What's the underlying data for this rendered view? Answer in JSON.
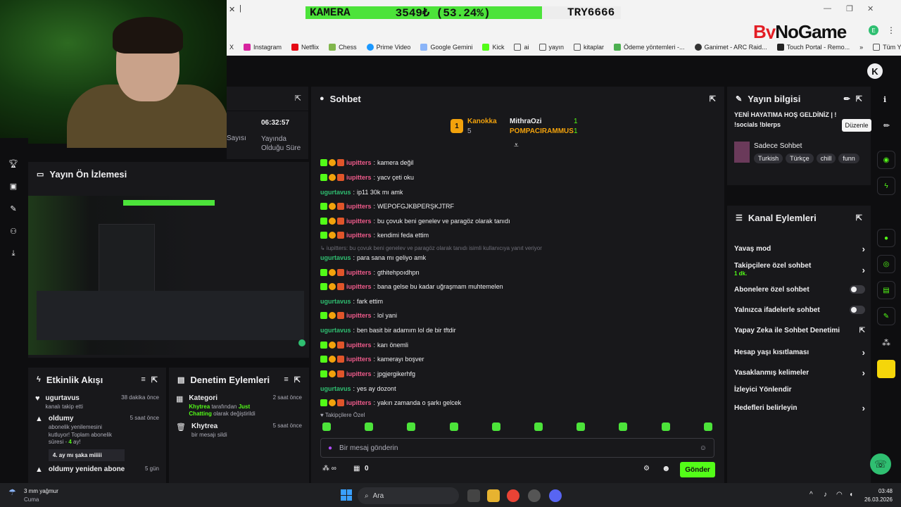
{
  "browser": {
    "stat_bar": {
      "label": "KAMERA",
      "value": "3549₺ (53.24%)",
      "fill_percent": 75,
      "code": "TRY6666"
    },
    "bookmarks": [
      "X",
      "Instagram",
      "Netflix",
      "Chess",
      "Prime Video",
      "Google Gemini",
      "Kick",
      "ai",
      "yayın",
      "kitaplar",
      "Ödeme yöntemleri -...",
      "Ganimet - ARC Raid...",
      "Touch Portal - Remo...",
      "Tüm Yer İşaretleri"
    ],
    "logo": {
      "by": "By",
      "rest": "NoGame"
    },
    "badge": "E"
  },
  "stats": {
    "time": "06:32:57",
    "time_label": "Yayında Olduğu Süre",
    "left_label": "Sayısı"
  },
  "preview": {
    "title": "Yayın Ön İzlemesi"
  },
  "activity": {
    "title": "Etkinlik Akışı",
    "items": [
      {
        "name": "ugurtavus",
        "sub": "kanalı takip etti",
        "time": "38 dakika önce"
      },
      {
        "name": "oldumy",
        "sub": "abonelik yenilemesini kutluyor! Toplam abonelik süresi -",
        "months": "4",
        "sub2": "ay!",
        "quote": "4. ay mı şaka miiiii",
        "time": "5 saat önce"
      },
      {
        "name": "oldumy yeniden abone",
        "time": "5 gün"
      }
    ]
  },
  "moderation": {
    "title": "Denetim Eylemleri",
    "items": [
      {
        "name": "Kategori",
        "by": "Khytrea",
        "mid": "tarafından",
        "cat": "Just Chatting",
        "end": "olarak değiştirildi",
        "time": "2 saat önce"
      },
      {
        "name": "Khytrea",
        "sub": "bir mesajı sildi",
        "time": "5 saat önce"
      }
    ]
  },
  "chat": {
    "title": "Sohbet",
    "pinned": {
      "user1": "Kanokka",
      "count1": "5",
      "user2": "MithraOzi",
      "count2": "1",
      "user3": "POMPACIRAMMUS",
      "count3": "1",
      "rank": "1"
    },
    "messages": [
      {
        "user": "iupitters",
        "text": "kamera değil",
        "type": "p"
      },
      {
        "user": "iupitters",
        "text": "yacv çeti oku",
        "type": "p"
      },
      {
        "user": "ugurtavus",
        "text": "ip11 30k mı amk",
        "type": "g"
      },
      {
        "user": "iupitters",
        "text": "WEPOFGJKBPERŞKJTRF",
        "type": "p"
      },
      {
        "user": "iupitters",
        "text": "bu çovuk beni genelev ve paragöz olarak tanıdı",
        "type": "p"
      },
      {
        "user": "iupitters",
        "text": "kendimi feda ettim",
        "type": "p"
      },
      {
        "user": "",
        "text": "↳ iupitters: bu çovuk beni genelev ve paragöz olarak tanıdı isimli kullanıcıya yanıt veriyor",
        "type": "sys"
      },
      {
        "user": "ugurtavus",
        "text": "para sana mı geliyo amk",
        "type": "g"
      },
      {
        "user": "iupitters",
        "text": "gthitehpoıdhpn",
        "type": "p"
      },
      {
        "user": "iupitters",
        "text": "bana gelse bu kadar uğraşmam muhtemelen",
        "type": "p"
      },
      {
        "user": "ugurtavus",
        "text": "fark ettim",
        "type": "g"
      },
      {
        "user": "iupitters",
        "text": "lol yani",
        "type": "p"
      },
      {
        "user": "ugurtavus",
        "text": "ben basit bir adamım lol de bir tftdir",
        "type": "g"
      },
      {
        "user": "iupitters",
        "text": "karı önemli",
        "type": "p"
      },
      {
        "user": "iupitters",
        "text": "kamerayı boşver",
        "type": "p"
      },
      {
        "user": "iupitters",
        "text": "jpgjergikerhfg",
        "type": "p"
      },
      {
        "user": "ugurtavus",
        "text": "yes ay dozont",
        "type": "g"
      },
      {
        "user": "iupitters",
        "text": "yakın zamanda o şarkı gelcek",
        "type": "p"
      }
    ],
    "followers_only": "♥ Takipçilere Özel",
    "input_placeholder": "Bir mesaj gönderin",
    "count": "0",
    "send": "Gönder"
  },
  "info": {
    "title": "Yayın bilgisi",
    "stream_title": "YENİ HAYATIMA HOŞ GELDİNİZ | !",
    "stream_title2": "!socials !blerps",
    "category": "Sadece Sohbet",
    "tags": [
      "Turkish",
      "Türkçe",
      "chill",
      "funn"
    ],
    "tooltip": "Düzenle"
  },
  "actions": {
    "title": "Kanal Eylemleri",
    "rows": [
      {
        "label": "Yavaş mod",
        "kind": "chev"
      },
      {
        "label": "Takipçilere özel sohbet",
        "sub": "1 dk.",
        "kind": "chev"
      },
      {
        "label": "Abonelere özel sohbet",
        "kind": "toggle"
      },
      {
        "label": "Yalnızca ifadelerle sohbet",
        "kind": "toggle"
      },
      {
        "label": "Yapay Zeka ile Sohbet Denetimi",
        "kind": "ext"
      },
      {
        "label": "Hesap yaşı kısıtlaması",
        "kind": "chev"
      },
      {
        "label": "Yasaklanmış kelimeler",
        "kind": "chev"
      },
      {
        "label": "İzleyici Yönlendir",
        "kind": "none"
      },
      {
        "label": "Hedefleri belirleyin",
        "kind": "chev"
      }
    ]
  },
  "taskbar": {
    "weather": "3 mm yağmur",
    "weather_sub": "Cuma",
    "search": "Ara",
    "time": "03:48",
    "date": "26.03.2026"
  },
  "colors": {
    "accent": "#53fc18",
    "pink_user": "#ef5b8b",
    "green_user": "#2fbf71"
  }
}
